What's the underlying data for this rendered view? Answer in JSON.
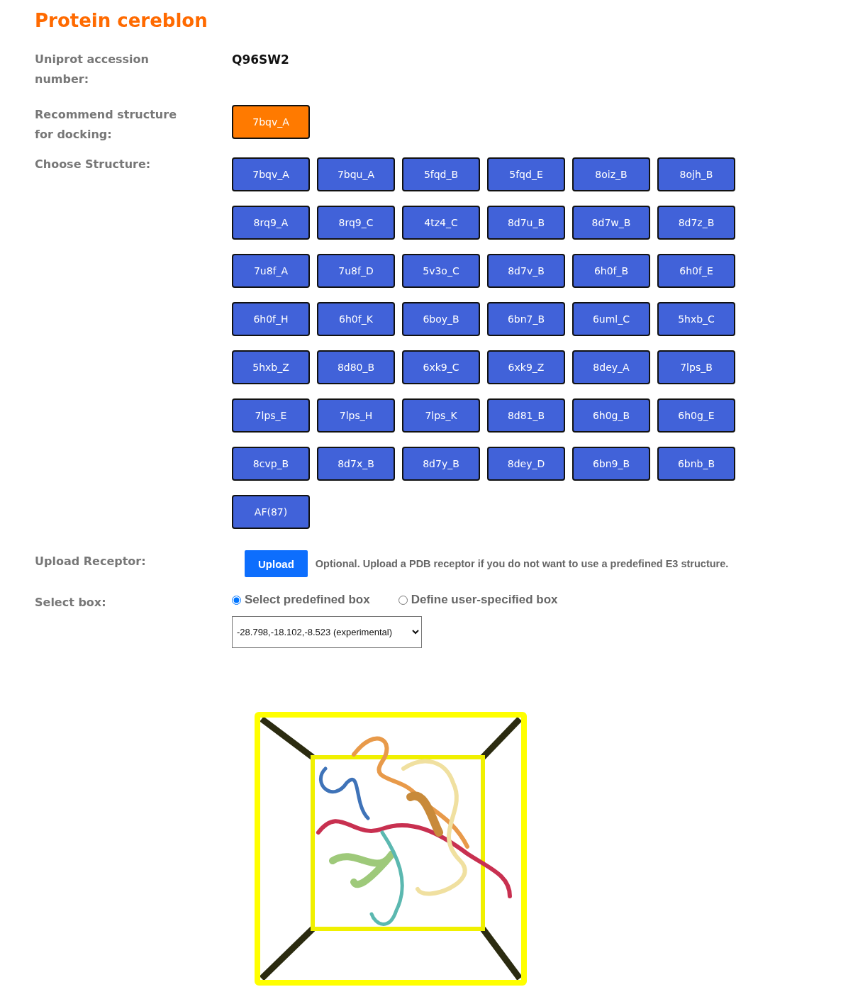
{
  "title": "Protein cereblon",
  "accession": {
    "label": "Uniprot accession number:",
    "value": "Q96SW2"
  },
  "recommend": {
    "label": "Recommend structure for docking:",
    "button": "7bqv_A"
  },
  "choose": {
    "label": "Choose Structure:",
    "structures": [
      "7bqv_A",
      "7bqu_A",
      "5fqd_B",
      "5fqd_E",
      "8oiz_B",
      "8ojh_B",
      "8rq9_A",
      "8rq9_C",
      "4tz4_C",
      "8d7u_B",
      "8d7w_B",
      "8d7z_B",
      "7u8f_A",
      "7u8f_D",
      "5v3o_C",
      "8d7v_B",
      "6h0f_B",
      "6h0f_E",
      "6h0f_H",
      "6h0f_K",
      "6boy_B",
      "6bn7_B",
      "6uml_C",
      "5hxb_C",
      "5hxb_Z",
      "8d80_B",
      "6xk9_C",
      "6xk9_Z",
      "8dey_A",
      "7lps_B",
      "7lps_E",
      "7lps_H",
      "7lps_K",
      "8d81_B",
      "6h0g_B",
      "6h0g_E",
      "8cvp_B",
      "8d7x_B",
      "8d7y_B",
      "8dey_D",
      "6bn9_B",
      "6bnb_B",
      "AF(87)"
    ]
  },
  "upload": {
    "label": "Upload Receptor:",
    "button": "Upload",
    "hint": "Optional. Upload a PDB receptor if you do not want to use a predefined E3 structure."
  },
  "select_box": {
    "label": "Select box:",
    "options": [
      {
        "label": "Select predefined box",
        "selected": true
      },
      {
        "label": "Define user-specified box",
        "selected": false
      }
    ],
    "dropdown": "-28.798,-18.102,-8.523 (experimental)"
  }
}
